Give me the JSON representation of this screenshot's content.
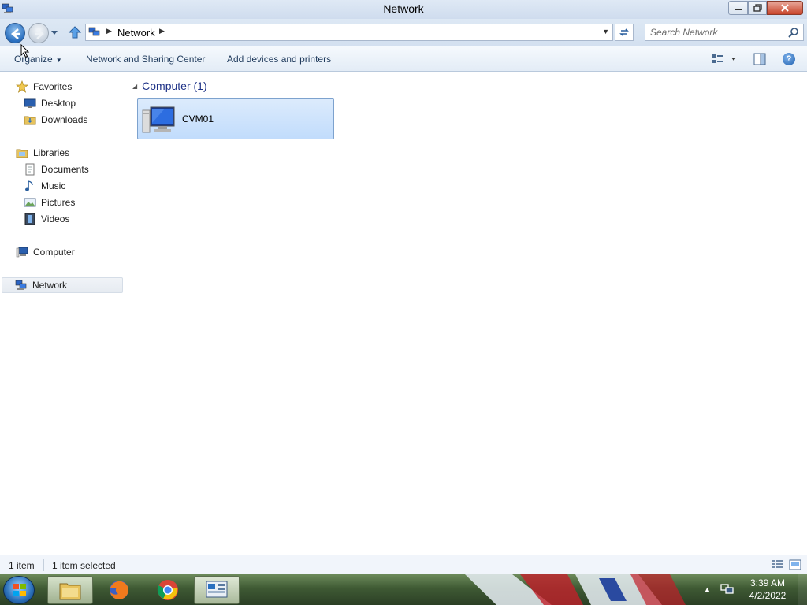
{
  "window": {
    "title": "Network"
  },
  "navbar": {
    "address_crumb": "Network",
    "search_placeholder": "Search Network"
  },
  "commandbar": {
    "organize_label": "Organize",
    "network_sharing_label": "Network and Sharing Center",
    "add_devices_label": "Add devices and printers"
  },
  "navpane": {
    "favorites": {
      "label": "Favorites",
      "items": [
        {
          "label": "Desktop",
          "icon": "desktop-icon"
        },
        {
          "label": "Downloads",
          "icon": "downloads-folder-icon"
        }
      ]
    },
    "libraries": {
      "label": "Libraries",
      "items": [
        {
          "label": "Documents",
          "icon": "documents-icon"
        },
        {
          "label": "Music",
          "icon": "music-icon"
        },
        {
          "label": "Pictures",
          "icon": "pictures-icon"
        },
        {
          "label": "Videos",
          "icon": "videos-icon"
        }
      ]
    },
    "computer": {
      "label": "Computer"
    },
    "network": {
      "label": "Network",
      "selected": true
    }
  },
  "content": {
    "group_header": "Computer (1)",
    "items": [
      {
        "label": "CVM01",
        "icon": "computer-icon",
        "selected": true
      }
    ]
  },
  "statusbar": {
    "item_count": "1 item",
    "selected_count": "1 item selected"
  },
  "taskbar": {
    "clock_time": "3:39 AM",
    "clock_date": "4/2/2022",
    "pinned": [
      "windows-explorer",
      "firefox",
      "chrome",
      "network-window"
    ]
  },
  "colors": {
    "group_header": "#1e3287",
    "selection_fill": "#c1dcfc",
    "selection_border": "#7da2ce",
    "command_text": "#1e395b"
  }
}
